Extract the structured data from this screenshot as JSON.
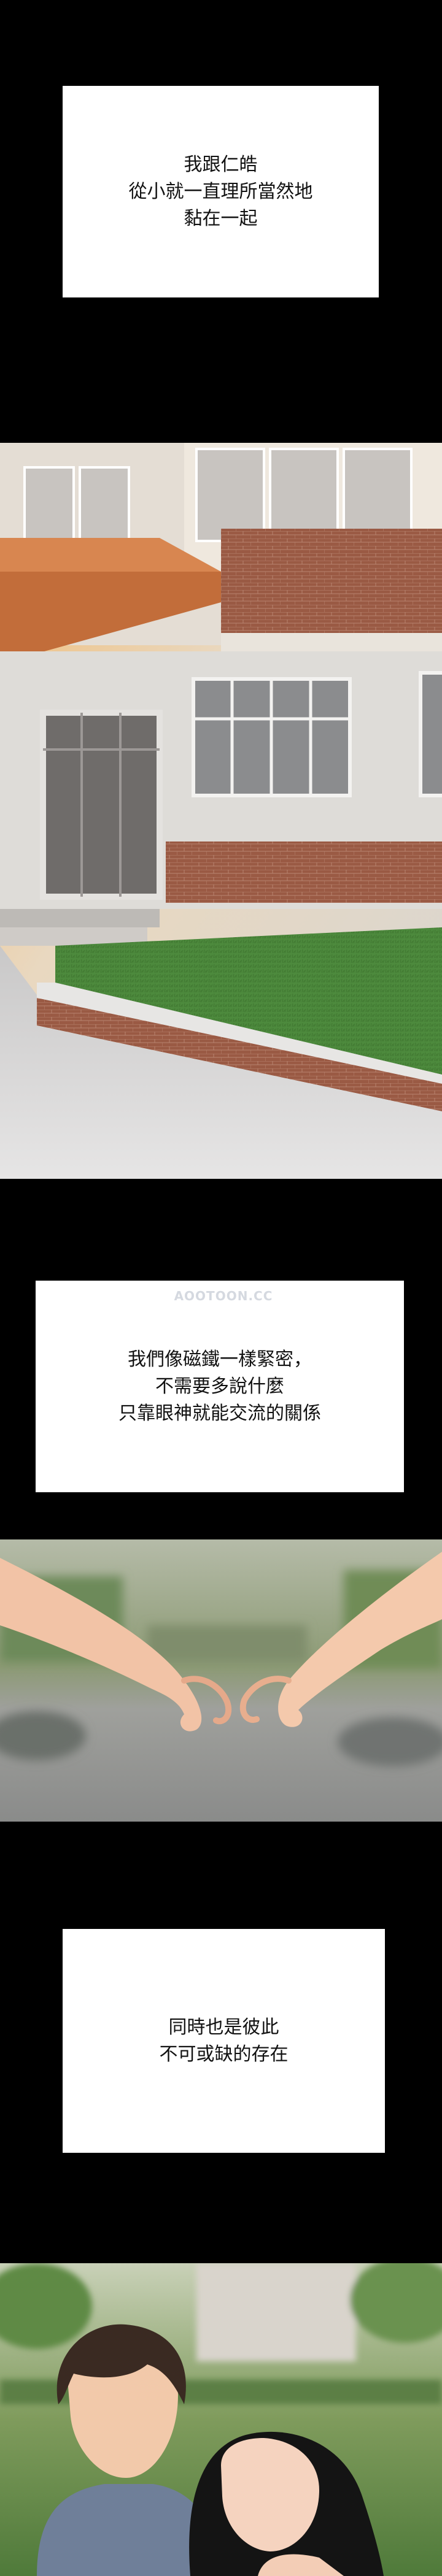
{
  "captions": [
    {
      "text": "我跟仁皓\n從小就一直理所當然地\n黏在一起"
    },
    {
      "text": "我們像磁鐵一樣緊密，\n不需要多說什麼\n只靠眼神就能交流的關係"
    },
    {
      "text": "同時也是彼此\n不可或缺的存在"
    }
  ],
  "watermark": "AOOTOON.CC",
  "colors": {
    "background": "#000000",
    "caption_bg": "#ffffff",
    "lawn": "#4d8a3d",
    "brick": "#9a5a44"
  }
}
